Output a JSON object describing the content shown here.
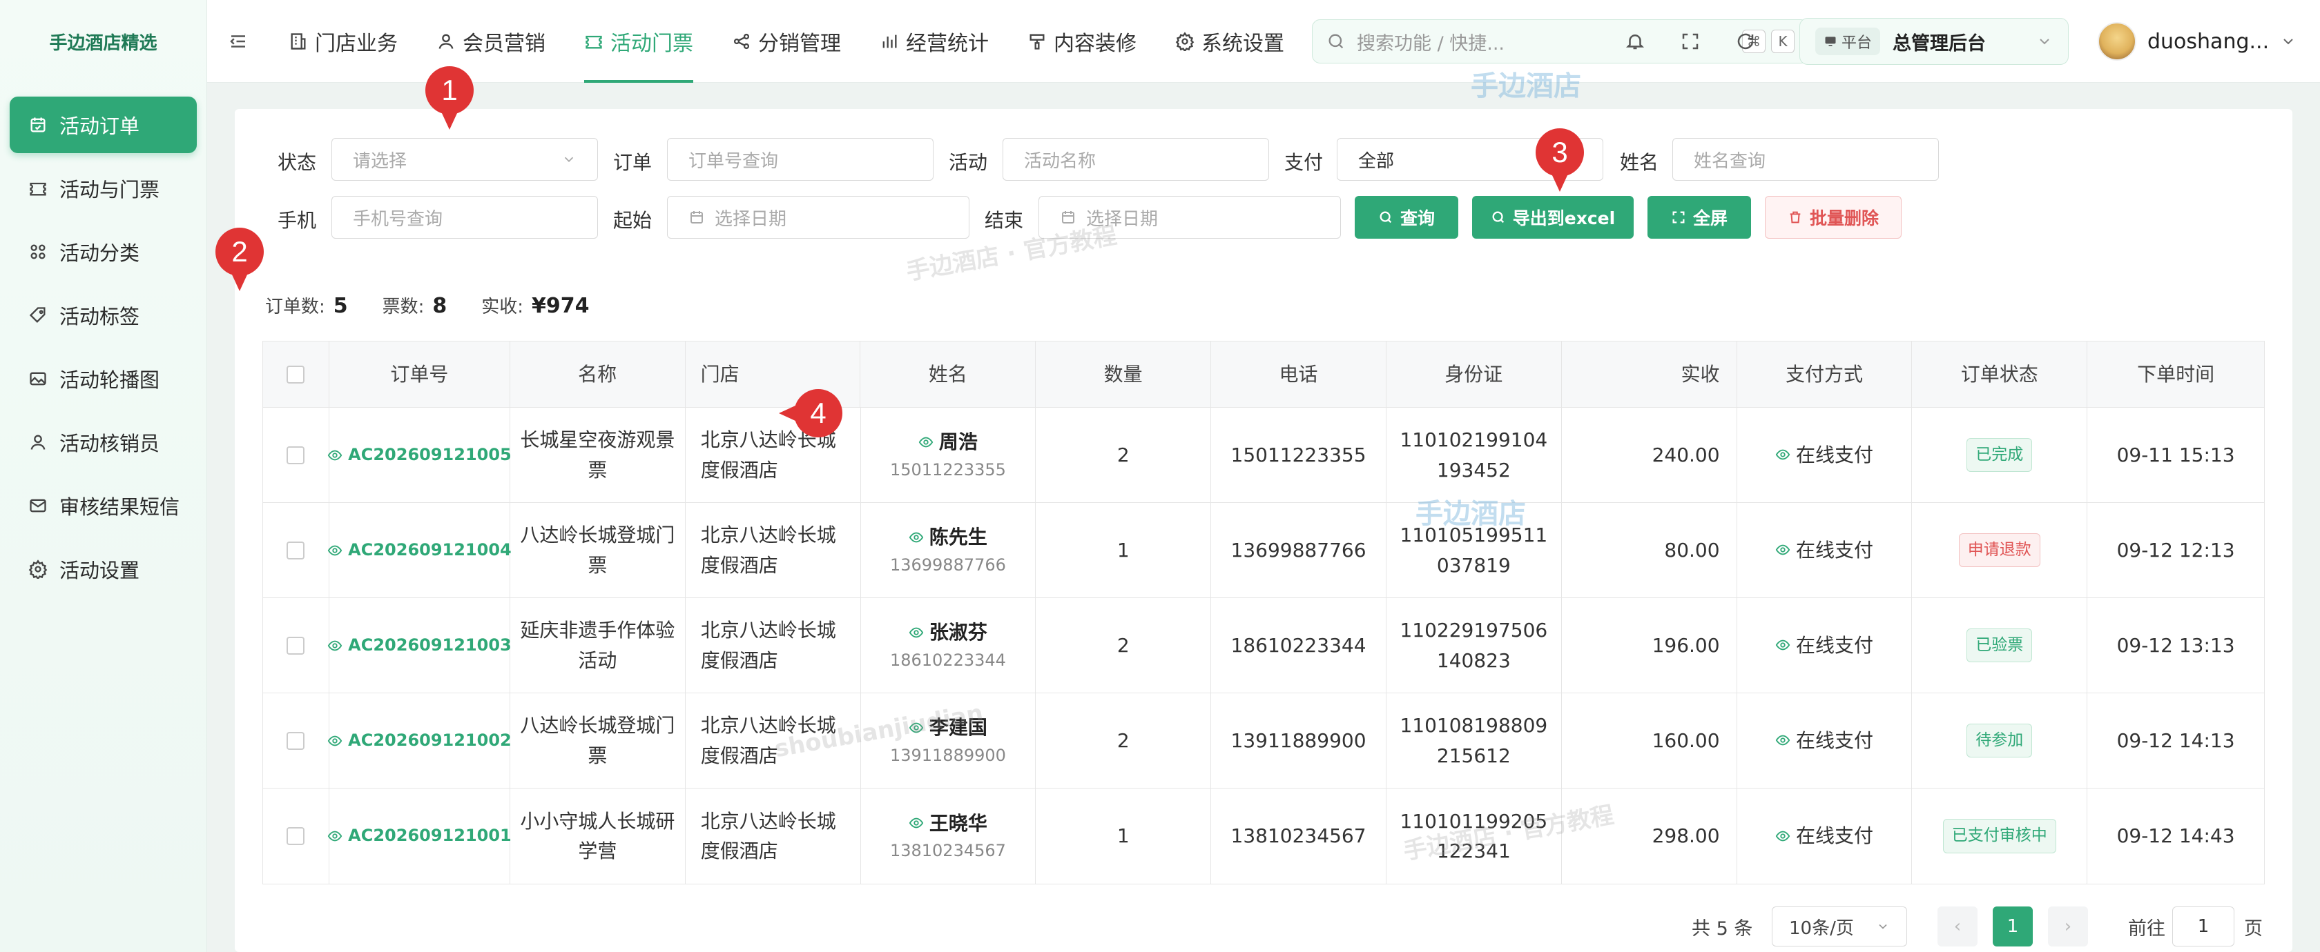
{
  "brand": "手边酒店精选",
  "sidebar": {
    "items": [
      {
        "label": "活动订单",
        "icon": "calendar-check-icon",
        "active": true
      },
      {
        "label": "活动与门票",
        "icon": "ticket-icon"
      },
      {
        "label": "活动分类",
        "icon": "grid-icon"
      },
      {
        "label": "活动标签",
        "icon": "tag-icon"
      },
      {
        "label": "活动轮播图",
        "icon": "image-icon"
      },
      {
        "label": "活动核销员",
        "icon": "user-icon"
      },
      {
        "label": "审核结果短信",
        "icon": "mail-icon"
      },
      {
        "label": "活动设置",
        "icon": "gear-icon"
      }
    ]
  },
  "topnav": {
    "tabs": [
      {
        "label": "门店业务",
        "icon": "building-icon"
      },
      {
        "label": "会员营销",
        "icon": "user-icon"
      },
      {
        "label": "活动门票",
        "icon": "ticket-icon",
        "active": true
      },
      {
        "label": "分销管理",
        "icon": "share-icon"
      },
      {
        "label": "经营统计",
        "icon": "bar-chart-icon"
      },
      {
        "label": "内容装修",
        "icon": "brush-icon"
      },
      {
        "label": "系统设置",
        "icon": "gear-icon"
      }
    ],
    "search_placeholder": "搜索功能 / 快捷...",
    "kbd": [
      "⌘",
      "K"
    ],
    "platform_tag": "平台",
    "platform_value": "总管理后台",
    "username": "duoshang..."
  },
  "filters": {
    "status_label": "状态",
    "status_placeholder": "请选择",
    "order_label": "订单",
    "order_placeholder": "订单号查询",
    "activity_label": "活动",
    "activity_placeholder": "活动名称",
    "pay_label": "支付",
    "pay_value": "全部",
    "name_label": "姓名",
    "name_placeholder": "姓名查询",
    "phone_label": "手机",
    "phone_placeholder": "手机号查询",
    "start_label": "起始",
    "start_placeholder": "选择日期",
    "end_label": "结束",
    "end_placeholder": "选择日期",
    "query_btn": "查询",
    "export_btn": "导出到excel",
    "fullscreen_btn": "全屏",
    "batch_delete_btn": "批量删除"
  },
  "stats": {
    "orders_label": "订单数:",
    "orders_value": "5",
    "tickets_label": "票数:",
    "tickets_value": "8",
    "paid_label": "实收:",
    "paid_value": "¥974"
  },
  "table": {
    "headers": [
      "订单号",
      "名称",
      "门店",
      "姓名",
      "数量",
      "电话",
      "身份证",
      "实收",
      "支付方式",
      "订单状态",
      "下单时间"
    ],
    "rows": [
      {
        "order": "AC202609121005",
        "name": "长城星空夜游观景票",
        "store": "北京八达岭长城度假酒店",
        "person": "周浩",
        "person_phone": "15011223355",
        "qty": "2",
        "phone": "15011223355",
        "id": "110102199104193452",
        "paid": "240.00",
        "pay": "在线支付",
        "status": "已完成",
        "status_tone": "green",
        "time": "09-11 15:13"
      },
      {
        "order": "AC202609121004",
        "name": "八达岭长城登城门票",
        "store": "北京八达岭长城度假酒店",
        "person": "陈先生",
        "person_phone": "13699887766",
        "qty": "1",
        "phone": "13699887766",
        "id": "110105199511037819",
        "paid": "80.00",
        "pay": "在线支付",
        "status": "申请退款",
        "status_tone": "red",
        "time": "09-12 12:13"
      },
      {
        "order": "AC202609121003",
        "name": "延庆非遗手作体验活动",
        "store": "北京八达岭长城度假酒店",
        "person": "张淑芬",
        "person_phone": "18610223344",
        "qty": "2",
        "phone": "18610223344",
        "id": "110229197506140823",
        "paid": "196.00",
        "pay": "在线支付",
        "status": "已验票",
        "status_tone": "green",
        "time": "09-12 13:13"
      },
      {
        "order": "AC202609121002",
        "name": "八达岭长城登城门票",
        "store": "北京八达岭长城度假酒店",
        "person": "李建国",
        "person_phone": "13911889900",
        "qty": "2",
        "phone": "13911889900",
        "id": "110108198809215612",
        "paid": "160.00",
        "pay": "在线支付",
        "status": "待参加",
        "status_tone": "green",
        "time": "09-12 14:13"
      },
      {
        "order": "AC202609121001",
        "name": "小小守城人长城研学营",
        "store": "北京八达岭长城度假酒店",
        "person": "王晓华",
        "person_phone": "13810234567",
        "qty": "1",
        "phone": "13810234567",
        "id": "110101199205122341",
        "paid": "298.00",
        "pay": "在线支付",
        "status": "已支付审核中",
        "status_tone": "green",
        "time": "09-12 14:43"
      }
    ]
  },
  "pagination": {
    "total": "共 5 条",
    "page_size": "10条/页",
    "prev": "‹",
    "current": "1",
    "next": "›",
    "goto_label": "前往",
    "goto_value": "1",
    "page_unit": "页"
  },
  "callouts": [
    "1",
    "2",
    "3",
    "4"
  ],
  "watermarks": {
    "logo": "手边酒店",
    "text1": "手边酒店 · 官方教程",
    "text2": "shoubianjiudian",
    "text3": "手边酒店 · 官方教程"
  }
}
